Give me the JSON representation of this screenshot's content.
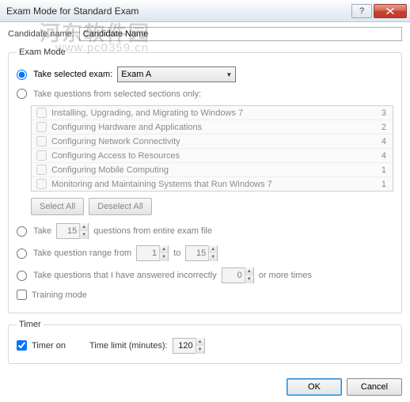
{
  "title": "Exam Mode for Standard Exam",
  "watermark_main": "河东软件园",
  "watermark_sub": "www.pc0359.cn",
  "candidate": {
    "label": "Candidate name:",
    "value": "Candidate Name"
  },
  "examMode": {
    "legend": "Exam Mode",
    "takeSelected": {
      "label": "Take selected exam:",
      "dropdown_value": "Exam A"
    },
    "fromSections": {
      "label": "Take questions from selected sections only:",
      "sections": [
        {
          "label": "Installing, Upgrading, and Migrating to Windows 7",
          "count": "3"
        },
        {
          "label": "Configuring Hardware and Applications",
          "count": "2"
        },
        {
          "label": "Configuring Network Connectivity",
          "count": "4"
        },
        {
          "label": "Configuring Access to Resources",
          "count": "4"
        },
        {
          "label": "Configuring Mobile Computing",
          "count": "1"
        },
        {
          "label": "Monitoring and Maintaining Systems that Run Windows 7",
          "count": "1"
        }
      ],
      "selectAll": "Select All",
      "deselectAll": "Deselect All"
    },
    "takeN": {
      "prefix": "Take",
      "value": "15",
      "suffix": "questions from entire exam file"
    },
    "range": {
      "prefix": "Take question range from",
      "from": "1",
      "mid": "to",
      "to": "15"
    },
    "incorrect": {
      "prefix": "Take questions that I have answered incorrectly",
      "value": "0",
      "suffix": "or more times"
    },
    "training": {
      "label": "Training mode"
    }
  },
  "timer": {
    "legend": "Timer",
    "on_label": "Timer on",
    "limit_label": "Time limit (minutes):",
    "limit_value": "120"
  },
  "buttons": {
    "ok": "OK",
    "cancel": "Cancel"
  }
}
